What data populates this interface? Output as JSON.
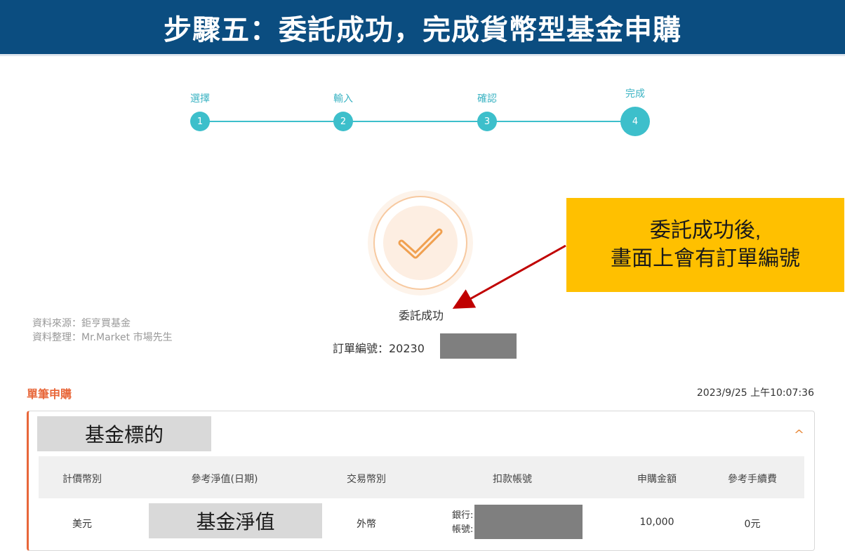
{
  "banner": {
    "title": "步驟五：委託成功，完成貨幣型基金申購"
  },
  "stepper": {
    "steps": [
      {
        "label": "選擇",
        "number": "1"
      },
      {
        "label": "輸入",
        "number": "2"
      },
      {
        "label": "確認",
        "number": "3"
      },
      {
        "label": "完成",
        "number": "4"
      }
    ],
    "active_step": 4,
    "accent_color": "#3dbfcb"
  },
  "result": {
    "status_text": "委託成功",
    "order_label": "訂單編號：20230"
  },
  "callout": {
    "line1": "委託成功後,",
    "line2": "畫面上會有訂單編號"
  },
  "source_note": {
    "line1": "資料來源：鉅亨買基金",
    "line2": "資料整理：Mr.Market 市場先生"
  },
  "section": {
    "title": "單筆申購",
    "timestamp": "2023/9/25 上午10:07:36"
  },
  "card": {
    "fund_label": "基金標的",
    "columns": [
      "計價幣別",
      "參考淨值(日期)",
      "交易幣別",
      "扣款帳號",
      "申購金額",
      "參考手續費"
    ],
    "row": {
      "currency": "美元",
      "nav_label": "基金淨值",
      "trade_currency": "外幣",
      "bank_label": "銀行:",
      "account_label": "帳號:",
      "amount": "10,000",
      "fee": "0元"
    }
  },
  "colors": {
    "banner": "#0b4d80",
    "accent_orange": "#e8673a",
    "callout_yellow": "#ffc000",
    "arrow_red": "#c00000"
  }
}
